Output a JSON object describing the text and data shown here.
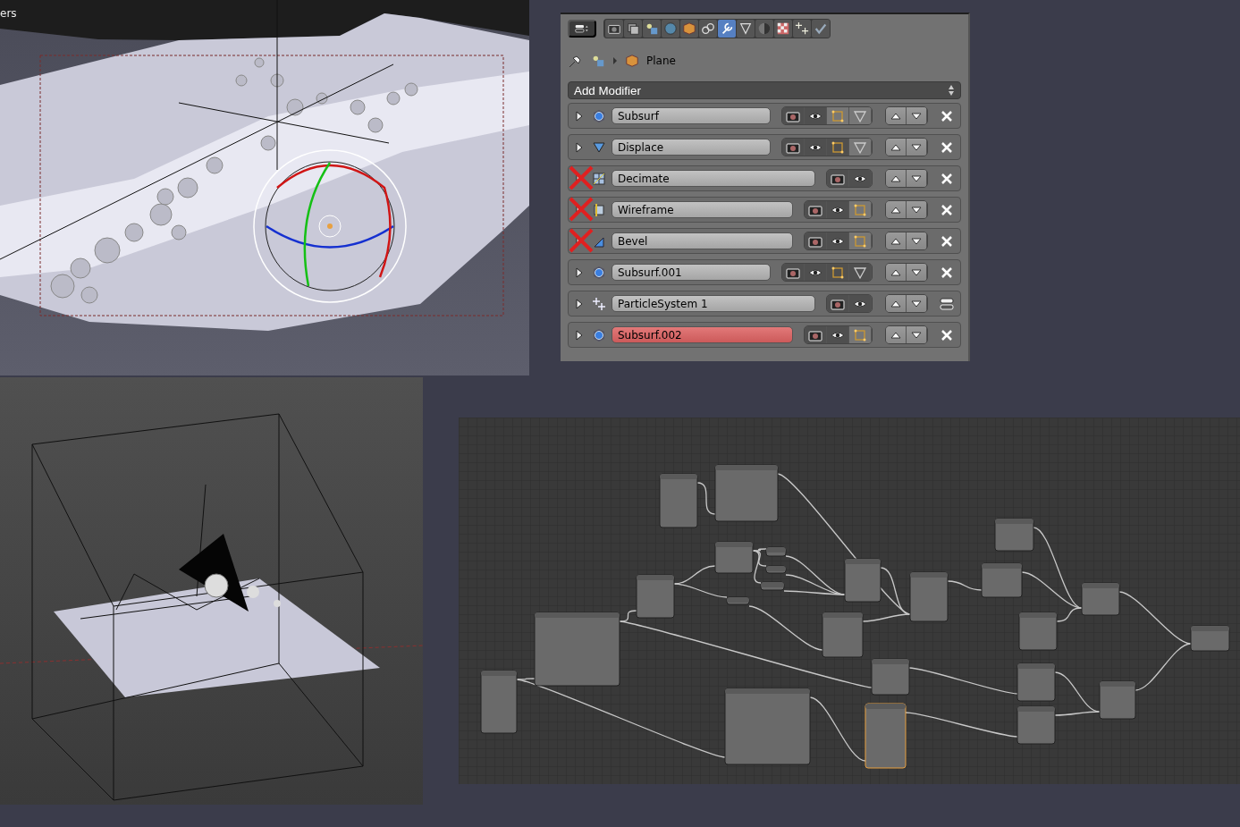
{
  "viewport_label": "ers",
  "properties": {
    "tabs": [
      {
        "kind": "render",
        "selected": false
      },
      {
        "kind": "layers",
        "selected": false
      },
      {
        "kind": "scene",
        "selected": false
      },
      {
        "kind": "world",
        "selected": false
      },
      {
        "kind": "object",
        "selected": false
      },
      {
        "kind": "constraints",
        "selected": false
      },
      {
        "kind": "modifiers",
        "selected": true
      },
      {
        "kind": "data",
        "selected": false
      },
      {
        "kind": "material",
        "selected": false
      },
      {
        "kind": "texture",
        "selected": false
      },
      {
        "kind": "particles",
        "selected": false
      },
      {
        "kind": "physics",
        "selected": false
      }
    ],
    "object_name": "Plane",
    "add_modifier": "Add Modifier",
    "modifiers": [
      {
        "name": "Subsurf",
        "kind": "subsurf",
        "crossed": false,
        "error": false,
        "toggles": [
          {
            "kind": "render",
            "on": true
          },
          {
            "kind": "view",
            "on": true
          },
          {
            "kind": "edit",
            "on": false
          },
          {
            "kind": "cage",
            "on": false
          }
        ],
        "end_button": {
          "kind": "remove"
        }
      },
      {
        "name": "Displace",
        "kind": "displace",
        "crossed": false,
        "error": false,
        "toggles": [
          {
            "kind": "render",
            "on": true
          },
          {
            "kind": "view",
            "on": true
          },
          {
            "kind": "edit",
            "on": true
          },
          {
            "kind": "cage",
            "on": false
          }
        ],
        "end_button": {
          "kind": "remove"
        }
      },
      {
        "name": "Decimate",
        "kind": "decimate",
        "crossed": true,
        "error": false,
        "toggles": [
          {
            "kind": "render",
            "on": true
          },
          {
            "kind": "view",
            "on": true
          }
        ],
        "end_button": {
          "kind": "remove"
        }
      },
      {
        "name": "Wireframe",
        "kind": "wireframe",
        "crossed": true,
        "error": false,
        "toggles": [
          {
            "kind": "render",
            "on": true
          },
          {
            "kind": "view",
            "on": true
          },
          {
            "kind": "edit",
            "on": false
          }
        ],
        "end_button": {
          "kind": "remove"
        }
      },
      {
        "name": "Bevel",
        "kind": "bevel",
        "crossed": true,
        "error": false,
        "toggles": [
          {
            "kind": "render",
            "on": true
          },
          {
            "kind": "view",
            "on": true
          },
          {
            "kind": "edit",
            "on": false
          }
        ],
        "end_button": {
          "kind": "remove"
        }
      },
      {
        "name": "Subsurf.001",
        "kind": "subsurf",
        "crossed": false,
        "error": false,
        "toggles": [
          {
            "kind": "render",
            "on": true
          },
          {
            "kind": "view",
            "on": true
          },
          {
            "kind": "edit",
            "on": true
          },
          {
            "kind": "cage",
            "on": true
          }
        ],
        "end_button": {
          "kind": "remove"
        }
      },
      {
        "name": "ParticleSystem 1",
        "kind": "particles",
        "crossed": false,
        "error": false,
        "toggles": [
          {
            "kind": "render",
            "on": true
          },
          {
            "kind": "view",
            "on": true
          }
        ],
        "end_button": {
          "kind": "settings"
        }
      },
      {
        "name": "Subsurf.002",
        "kind": "subsurf",
        "crossed": false,
        "error": true,
        "toggles": [
          {
            "kind": "render",
            "on": true
          },
          {
            "kind": "view",
            "on": true
          },
          {
            "kind": "edit",
            "on": false
          }
        ],
        "end_button": {
          "kind": "remove"
        }
      }
    ]
  }
}
